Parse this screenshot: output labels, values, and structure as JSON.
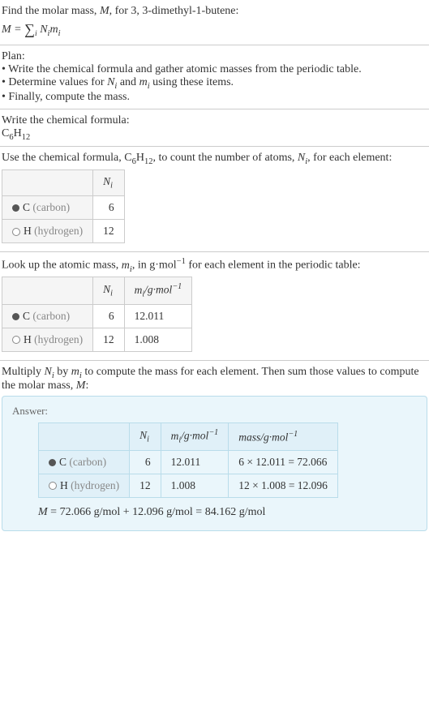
{
  "intro": {
    "line1_pre": "Find the molar mass, ",
    "line1_var": "M",
    "line1_post": ", for 3, 3-dimethyl-1-butene:",
    "eq_lhs": "M",
    "eq_eq": " = ",
    "eq_sum": "∑",
    "eq_idx": "i",
    "eq_rhs_a": "N",
    "eq_rhs_b": "m"
  },
  "plan": {
    "title": "Plan:",
    "b1": "• Write the chemical formula and gather atomic masses from the periodic table.",
    "b2_pre": "• Determine values for ",
    "b2_v1": "N",
    "b2_mid": " and ",
    "b2_v2": "m",
    "b2_post": " using these items.",
    "b3": "• Finally, compute the mass."
  },
  "formula_section": {
    "label": "Write the chemical formula:",
    "formula_a": "C",
    "formula_a_sub": "6",
    "formula_b": "H",
    "formula_b_sub": "12"
  },
  "count_section": {
    "text_pre": "Use the chemical formula, ",
    "text_post": ", to count the number of atoms, ",
    "text_var": "N",
    "text_end": ", for each element:",
    "hdr_blank": "",
    "hdr_n": "N",
    "row_c_label_a": "C",
    "row_c_label_b": " (carbon)",
    "row_c_val": "6",
    "row_h_label_a": "H",
    "row_h_label_b": " (hydrogen)",
    "row_h_val": "12"
  },
  "mass_section": {
    "text_pre": "Look up the atomic mass, ",
    "text_var": "m",
    "text_mid": ", in g·mol",
    "text_exp": "−1",
    "text_post": " for each element in the periodic table:",
    "hdr_m": "m",
    "hdr_m_unit": "/g·mol",
    "row_c_mass": "12.011",
    "row_h_mass": "1.008"
  },
  "compute_section": {
    "text_a": "Multiply ",
    "text_b": " by ",
    "text_c": " to compute the mass for each element. Then sum those values to compute the molar mass, ",
    "text_d": ":"
  },
  "answer": {
    "label": "Answer:",
    "hdr_mass": "mass/g·mol",
    "row_c_calc": "6 × 12.011 = 72.066",
    "row_h_calc": "12 × 1.008 = 12.096",
    "final_lhs": "M",
    "final_rhs": " = 72.066 g/mol + 12.096 g/mol = 84.162 g/mol"
  },
  "chart_data": {
    "type": "table",
    "title": "Molar mass computation for 3,3-dimethyl-1-butene (C6H12)",
    "columns": [
      "element",
      "N_i",
      "m_i_g_per_mol",
      "mass_g_per_mol"
    ],
    "rows": [
      {
        "element": "C (carbon)",
        "N_i": 6,
        "m_i_g_per_mol": 12.011,
        "mass_g_per_mol": 72.066
      },
      {
        "element": "H (hydrogen)",
        "N_i": 12,
        "m_i_g_per_mol": 1.008,
        "mass_g_per_mol": 12.096
      }
    ],
    "molar_mass_g_per_mol": 84.162
  }
}
